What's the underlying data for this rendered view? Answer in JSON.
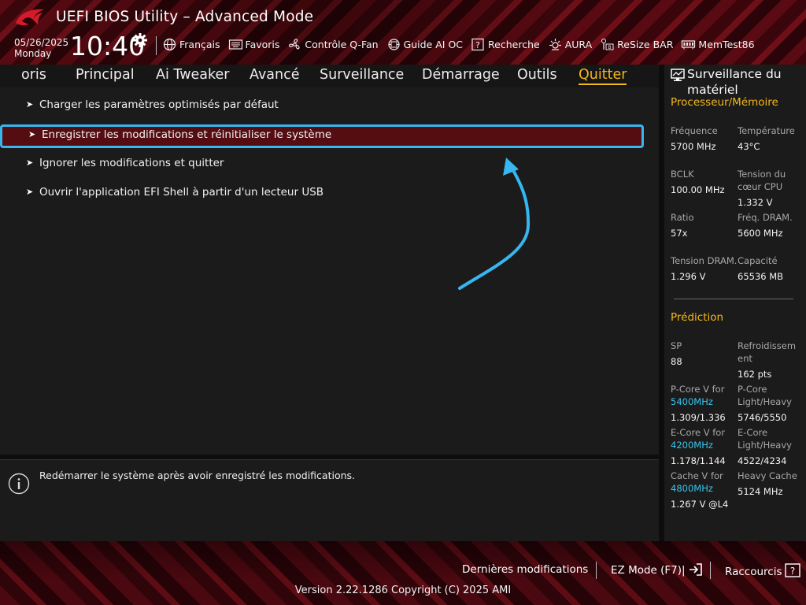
{
  "header": {
    "title": "UEFI BIOS Utility – Advanced Mode",
    "date": "05/26/2025",
    "day": "Monday",
    "time": "10:40",
    "toolbar": [
      {
        "label": "Français",
        "icon": "globe-icon"
      },
      {
        "label": "Favoris",
        "icon": "keyboard-icon"
      },
      {
        "label": "Contrôle Q-Fan",
        "icon": "fan-icon"
      },
      {
        "label": "Guide AI OC",
        "icon": "chip-icon"
      },
      {
        "label": "Recherche",
        "icon": "question-icon"
      },
      {
        "label": "AURA",
        "icon": "light-icon"
      },
      {
        "label": "ReSize BAR",
        "icon": "resize-bar-icon"
      },
      {
        "label": "MemTest86",
        "icon": "memory-icon"
      }
    ]
  },
  "tabs": [
    {
      "label": "oris"
    },
    {
      "label": "Principal"
    },
    {
      "label": "Ai Tweaker"
    },
    {
      "label": "Avancé"
    },
    {
      "label": "Surveillance"
    },
    {
      "label": "Démarrage"
    },
    {
      "label": "Outils"
    },
    {
      "label": "Quitter"
    }
  ],
  "menu": [
    {
      "label": "Charger les paramètres optimisés par défaut"
    },
    {
      "label": "Enregistrer les modifications et réinitialiser le système"
    },
    {
      "label": "Ignorer les modifications et quitter"
    },
    {
      "label": "Ouvrir l'application EFI Shell à partir d'un lecteur USB"
    }
  ],
  "help_text": "Redémarrer le système après avoir enregistré les modifications.",
  "panel": {
    "title": "Surveillance du matériel",
    "cpu_section": "Processeur/Mémoire",
    "cpu": [
      {
        "label": "Fréquence",
        "value": "5700 MHz"
      },
      {
        "label": "Température",
        "value": "43°C"
      },
      {
        "label": "BCLK",
        "value": "100.00 MHz"
      },
      {
        "label": "Tension du cœur CPU",
        "value": "1.332 V"
      },
      {
        "label": "Ratio",
        "value": "57x"
      },
      {
        "label": "Fréq. DRAM.",
        "value": "5600 MHz"
      },
      {
        "label": "Tension DRAM.",
        "value": "1.296 V"
      },
      {
        "label": "Capacité",
        "value": "65536 MB"
      }
    ],
    "prediction_section": "Prédiction",
    "prediction": [
      {
        "label": "SP",
        "value": "88"
      },
      {
        "label": "Refroidissement",
        "value": "162 pts"
      },
      {
        "label": "P-Core V for",
        "freq": "5400MHz",
        "value": "1.309/1.336"
      },
      {
        "label": "P-Core Light/Heavy",
        "value": "5746/5550"
      },
      {
        "label": "E-Core V for",
        "freq": "4200MHz",
        "value": "1.178/1.144"
      },
      {
        "label": "E-Core Light/Heavy",
        "value": "4522/4234"
      },
      {
        "label": "Cache V for",
        "freq": "4800MHz",
        "value": "1.267 V @L4"
      },
      {
        "label": "Heavy Cache",
        "value": "5124 MHz"
      }
    ]
  },
  "footer": {
    "last_changes": "Dernières modifications",
    "ez_mode": "EZ Mode (F7)|",
    "shortcuts": "Raccourcis",
    "version": "Version 2.22.1286 Copyright (C) 2025 AMI"
  },
  "colors": {
    "accent": "#f3b81a",
    "highlight_border": "#37b6ef",
    "selected_bg": "#550d12",
    "freq_text": "#37c6ef"
  }
}
